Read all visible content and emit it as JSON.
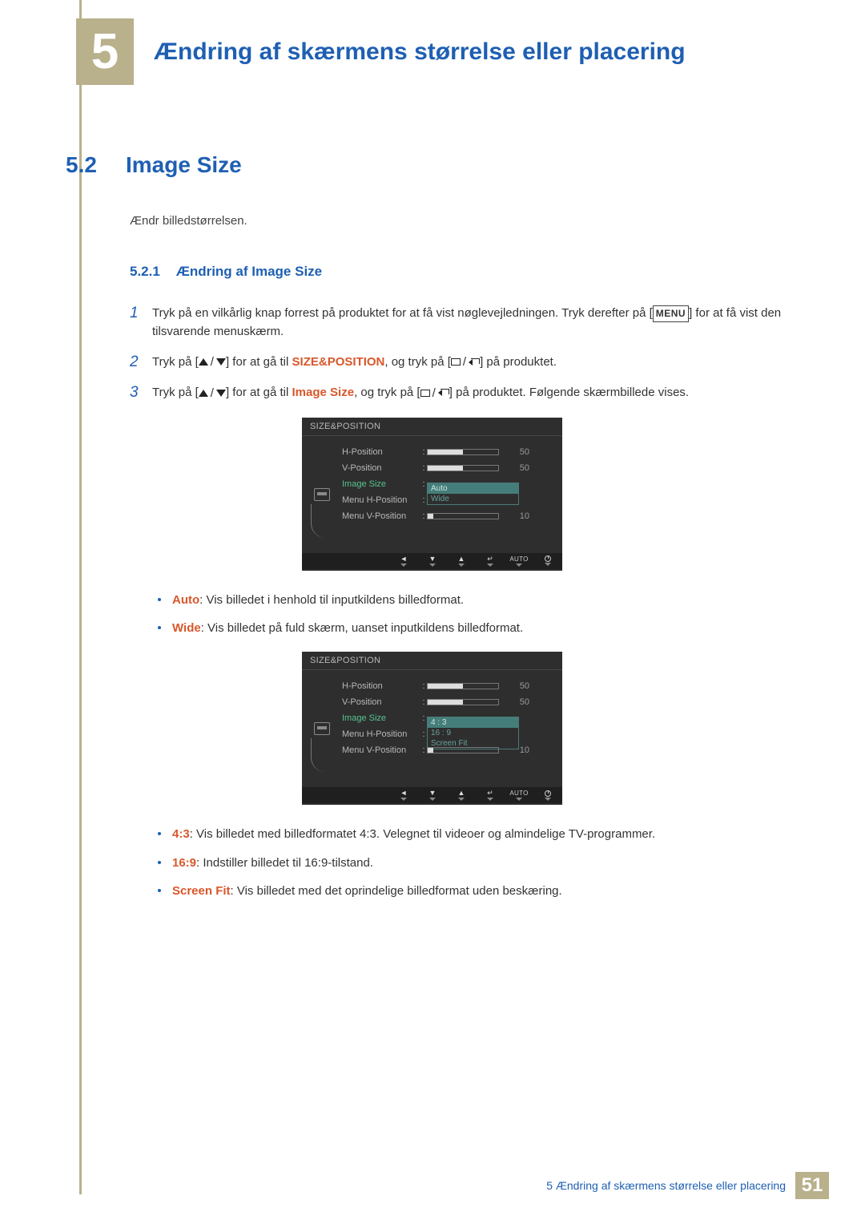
{
  "chapter": {
    "number": "5",
    "title": "Ændring af skærmens størrelse eller placering"
  },
  "section": {
    "number": "5.2",
    "title": "Image Size",
    "intro": "Ændr billedstørrelsen."
  },
  "subsection": {
    "number": "5.2.1",
    "title": "Ændring af Image Size"
  },
  "steps": {
    "s1": {
      "n": "1",
      "pre": "Tryk på en vilkårlig knap forrest på produktet for at få vist nøglevejledningen. Tryk derefter på [",
      "menu": "MENU",
      "post": "] for at få vist den tilsvarende menuskærm."
    },
    "s2": {
      "n": "2",
      "a": "Tryk på [",
      "b": "] for at gå til ",
      "kw": "SIZE&POSITION",
      "c": ", og tryk på [",
      "d": "] på produktet."
    },
    "s3": {
      "n": "3",
      "a": "Tryk på [",
      "b": "] for at gå til ",
      "kw": "Image Size",
      "c": ", og tryk på [",
      "d": "] på produktet. Følgende skærmbillede vises."
    }
  },
  "osd": {
    "title": "SIZE&POSITION",
    "rows": {
      "h": {
        "label": "H-Position",
        "value": "50",
        "fill": 50
      },
      "v": {
        "label": "V-Position",
        "value": "50",
        "fill": 50
      },
      "is": {
        "label": "Image Size"
      },
      "mh": {
        "label": "Menu H-Position"
      },
      "mv": {
        "label": "Menu V-Position",
        "value": "10",
        "fill": 10
      }
    },
    "dropdown1": {
      "o1": "Auto",
      "o2": "Wide"
    },
    "dropdown2": {
      "o1": "4 : 3",
      "o2": "16 : 9",
      "o3": "Screen Fit"
    },
    "nav_auto": "AUTO"
  },
  "bullets1": {
    "b1": {
      "kw": "Auto",
      "txt": ": Vis billedet i henhold til inputkildens billedformat."
    },
    "b2": {
      "kw": "Wide",
      "txt": ": Vis billedet på fuld skærm, uanset inputkildens billedformat."
    }
  },
  "bullets2": {
    "b1": {
      "kw": "4:3",
      "txt": ": Vis billedet med billedformatet 4:3. Velegnet til videoer og almindelige TV-programmer."
    },
    "b2": {
      "kw": "16:9",
      "txt": ": Indstiller billedet til 16:9-tilstand."
    },
    "b3": {
      "kw": "Screen Fit",
      "txt": ": Vis billedet med det oprindelige billedformat uden beskæring."
    }
  },
  "footer": {
    "text": "5 Ændring af skærmens størrelse eller placering",
    "page": "51"
  }
}
